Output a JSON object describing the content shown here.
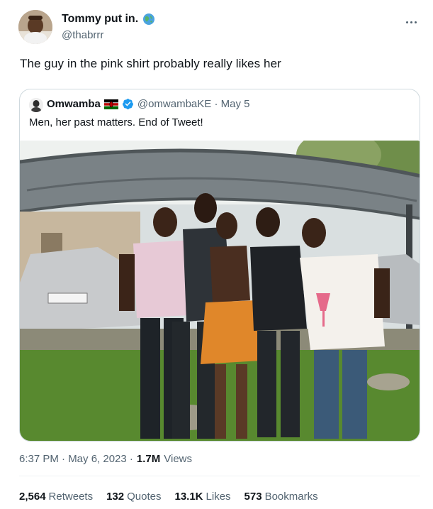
{
  "author": {
    "display_name": "Tommy put in.",
    "handle": "@thabrrr",
    "badge_icon": "globe-icon",
    "avatar_icon": "avatar-photo"
  },
  "tweet_text": "The guy in the pink shirt probably really likes her",
  "quoted": {
    "display_name": "Omwamba",
    "flag_icon": "kenya-flag-icon",
    "verified_icon": "verified-icon",
    "handle_date": "@omwambaKE · May 5",
    "text": "Men, her past matters. End of Tweet!",
    "photo_icon": "group-photo"
  },
  "meta": {
    "timestamp": "6:37 PM · May 6, 2023 ·",
    "views_count": "1.7M",
    "views_label": "Views"
  },
  "stats": [
    {
      "count": "2,564",
      "label": "Retweets"
    },
    {
      "count": "132",
      "label": "Quotes"
    },
    {
      "count": "13.1K",
      "label": "Likes"
    },
    {
      "count": "573",
      "label": "Bookmarks"
    }
  ],
  "colors": {
    "text_primary": "#0f1419",
    "text_secondary": "#536471",
    "border": "#cfd9de",
    "verified": "#1d9bf0"
  }
}
